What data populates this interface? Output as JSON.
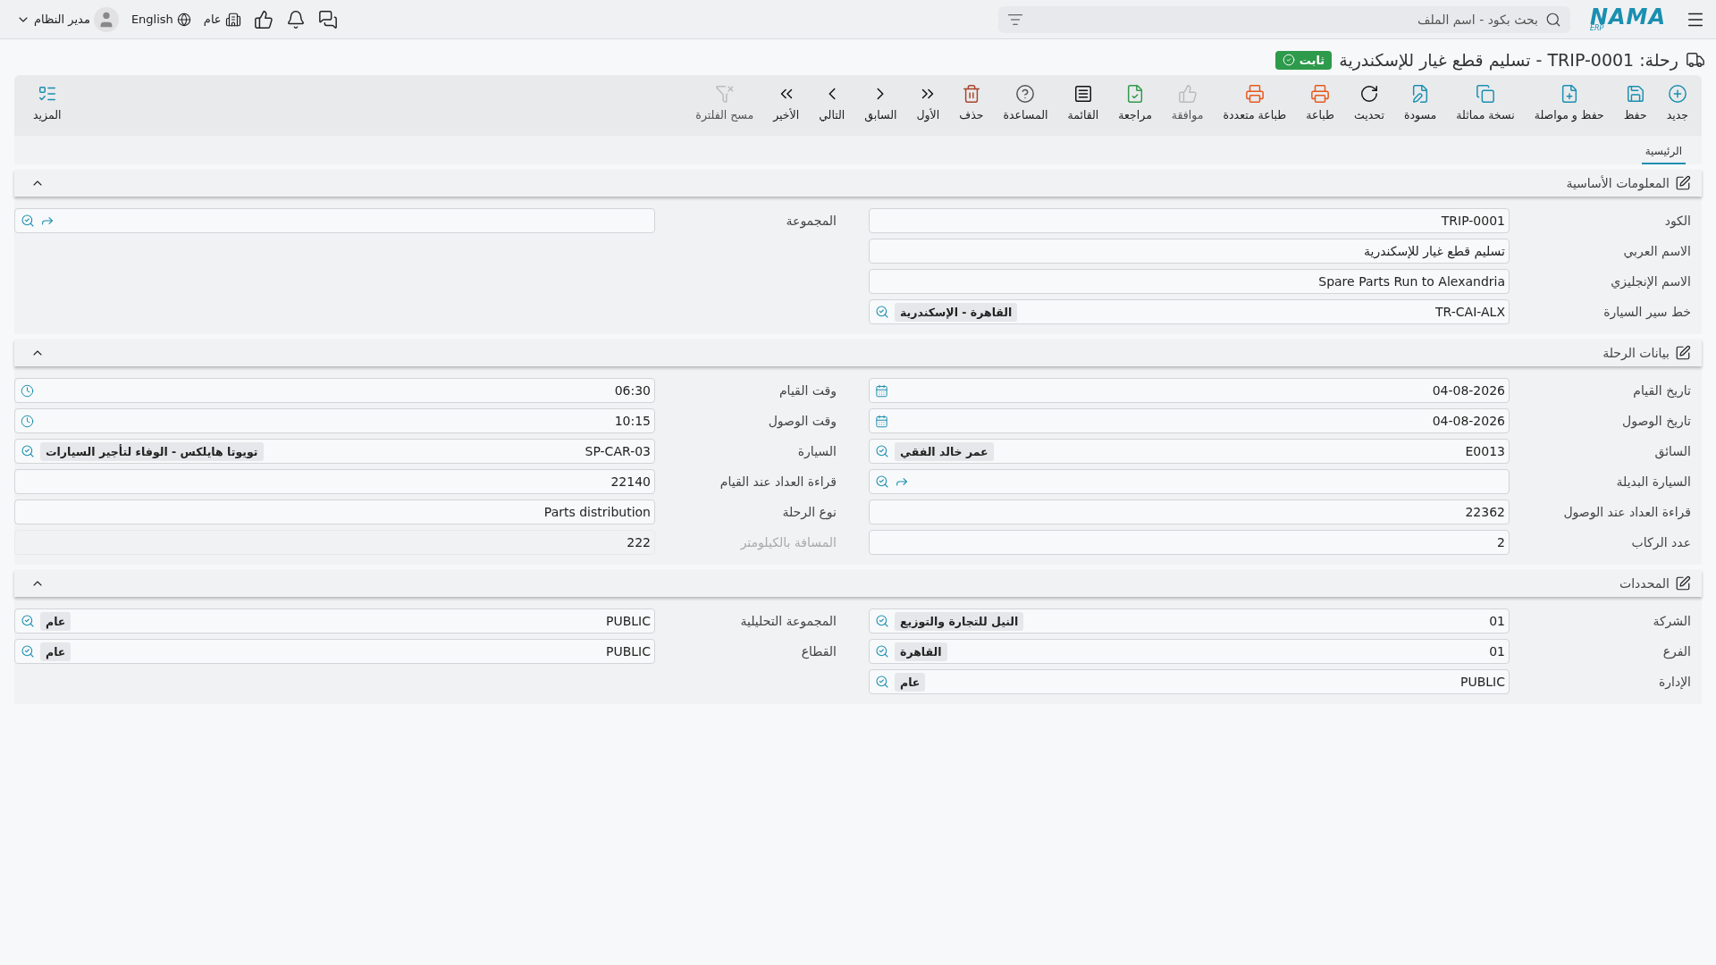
{
  "topbar": {
    "logo": {
      "name": "NAMA",
      "sub": "ERP"
    },
    "search": {
      "placeholder": "بحث بكود - اسم الملف"
    },
    "company": "عام",
    "language": "English",
    "user": "مدير النظام"
  },
  "title": {
    "text": "رحلة: TRIP-0001 - تسليم قطع غيار للإسكندرية",
    "status": "ثابت"
  },
  "toolbar": [
    {
      "label": "جديد",
      "disabled": false
    },
    {
      "label": "حفظ",
      "disabled": false
    },
    {
      "label": "حفظ و مواصلة",
      "disabled": false
    },
    {
      "label": "نسخة مماثلة",
      "disabled": false
    },
    {
      "label": "مسودة",
      "disabled": false
    },
    {
      "label": "تحديث",
      "disabled": false
    },
    {
      "label": "طباعة",
      "disabled": false
    },
    {
      "label": "طباعة متعددة",
      "disabled": false
    },
    {
      "label": "موافقة",
      "disabled": true
    },
    {
      "label": "مراجعة",
      "disabled": false
    },
    {
      "label": "القائمة",
      "disabled": false
    },
    {
      "label": "المساعدة",
      "disabled": false
    },
    {
      "label": "حذف",
      "disabled": false
    },
    {
      "label": "الأول",
      "disabled": false
    },
    {
      "label": "السابق",
      "disabled": false
    },
    {
      "label": "التالي",
      "disabled": false
    },
    {
      "label": "الأخير",
      "disabled": false
    },
    {
      "label": "مسح الفلترة",
      "disabled": true
    }
  ],
  "more": "المزيد",
  "tabs": [
    {
      "label": "الرئيسية",
      "selected": true
    }
  ],
  "sections": [
    {
      "title": "المعلومات الأساسية",
      "expanded": true,
      "column_1": [
        {
          "label": "الكود",
          "value": "TRIP-0001",
          "kind": "text",
          "disabled": false
        },
        {
          "label": "الاسم العربي",
          "value": "تسليم قطع غيار للإسكندرية",
          "kind": "text",
          "disabled": false
        },
        {
          "label": "الاسم الإنجليزي",
          "value": "Spare Parts Run to Alexandria",
          "kind": "text",
          "disabled": false
        },
        {
          "label": "خط سير السيارة",
          "value": "TR-CAI-ALX",
          "description": "القاهرة - الإسكندرية",
          "kind": "lookup",
          "disabled": false
        }
      ],
      "column_2": [
        {
          "label": "المجموعة",
          "kind": "lookup",
          "disabled": false
        }
      ]
    },
    {
      "title": "بيانات الرحلة",
      "expanded": true,
      "column_1": [
        {
          "label": "تاريخ القيام",
          "value": "04-08-2026",
          "kind": "date",
          "disabled": false
        },
        {
          "label": "تاريخ الوصول",
          "value": "04-08-2026",
          "kind": "date",
          "disabled": false
        },
        {
          "label": "السائق",
          "value": "E0013",
          "description": "عمر خالد الفقي",
          "kind": "lookup",
          "disabled": false
        },
        {
          "label": "السيارة البديلة",
          "kind": "lookup",
          "disabled": false
        },
        {
          "label": "قراءة العداد عند الوصول",
          "value": "22362",
          "kind": "text",
          "disabled": false
        },
        {
          "label": "عدد الركاب",
          "value": "2",
          "kind": "text",
          "disabled": false
        }
      ],
      "column_2": [
        {
          "label": "وقت القيام",
          "value": "06:30",
          "kind": "time",
          "disabled": false
        },
        {
          "label": "وقت الوصول",
          "value": "10:15",
          "kind": "time",
          "disabled": false
        },
        {
          "label": "السيارة",
          "value": "SP-CAR-03",
          "description": "تويوتا هايلكس - الوفاء لتأجير السيارات",
          "kind": "lookup",
          "disabled": false
        },
        {
          "label": "قراءة العداد عند القيام",
          "value": "22140",
          "kind": "text",
          "disabled": false
        },
        {
          "label": "نوع الرحلة",
          "value": "Parts distribution",
          "kind": "text",
          "disabled": false
        },
        {
          "label": "المسافة بالكيلومتر",
          "value": "222",
          "kind": "text",
          "disabled": true
        }
      ]
    },
    {
      "title": "المحددات",
      "expanded": true,
      "column_1": [
        {
          "label": "الشركة",
          "value": "01",
          "description": "النيل للتجارة والتوزيع",
          "kind": "lookup",
          "disabled": false
        },
        {
          "label": "الفرع",
          "value": "01",
          "description": "القاهرة",
          "kind": "lookup",
          "disabled": false
        },
        {
          "label": "الإدارة",
          "value": "PUBLIC",
          "description": "عام",
          "kind": "lookup",
          "disabled": false
        }
      ],
      "column_2": [
        {
          "label": "المجموعة التحليلية",
          "value": "PUBLIC",
          "description": "عام",
          "kind": "lookup",
          "disabled": false
        },
        {
          "label": "القطاع",
          "value": "PUBLIC",
          "description": "عام",
          "kind": "lookup",
          "disabled": false
        }
      ]
    }
  ]
}
